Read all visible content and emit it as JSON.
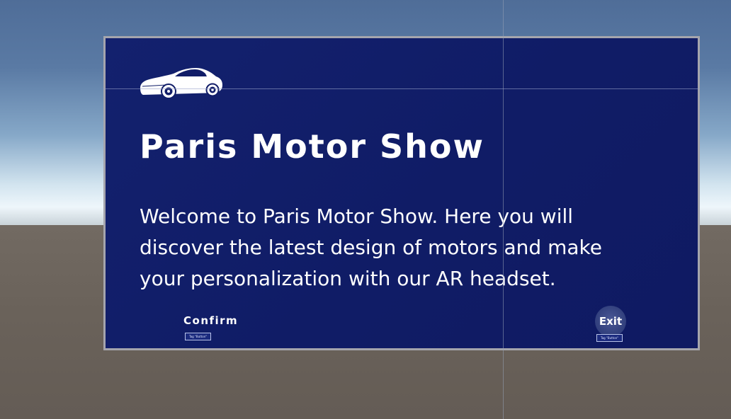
{
  "panel": {
    "title": "Paris Motor Show",
    "body": "Welcome to Paris Motor Show. Here you will discover the latest design of motors and make your personalization with our AR headset.",
    "logo_icon": "car-icon"
  },
  "buttons": {
    "confirm_label": "Confirm",
    "confirm_tag": "Tag \"Button\"",
    "exit_label": "Exit",
    "exit_tag": "Tag \"Button\""
  },
  "colors": {
    "panel_background": "#111d68",
    "panel_border": "#a5a5ad",
    "text": "#ffffff",
    "sky_top": "#4f6d98",
    "horizon": "#eef6fb",
    "ground": "#6a625a"
  }
}
